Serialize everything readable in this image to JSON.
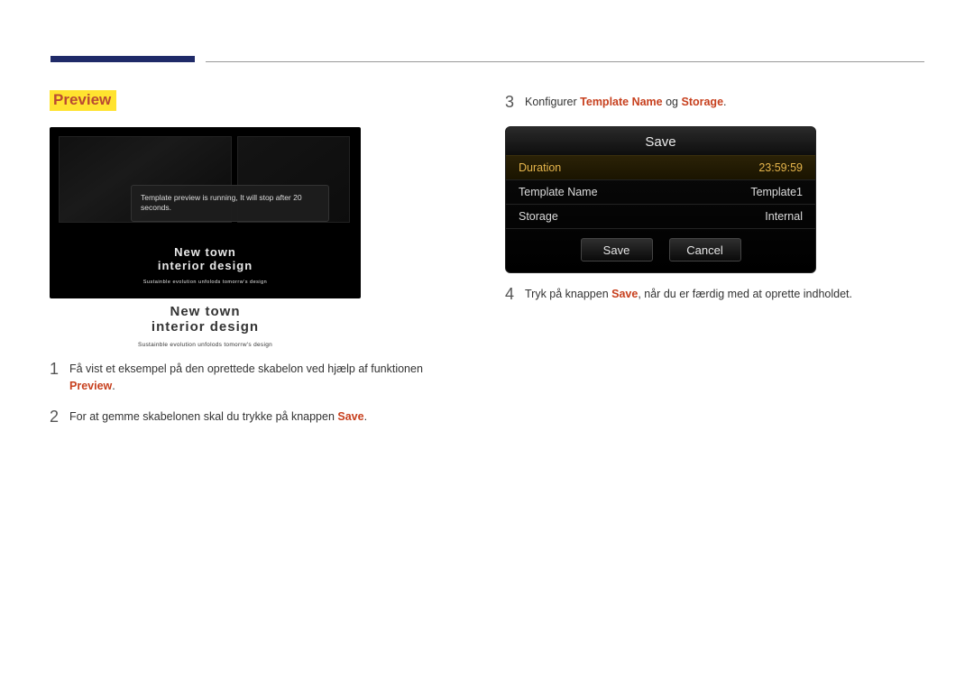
{
  "header": {
    "section_label": "Preview"
  },
  "preview_toast": "Template preview is running, It will stop after 20 seconds.",
  "preview_title_line1": "New town",
  "preview_title_line2": "interior design",
  "preview_subtitle": "Sustainble evolution unfolods tomorrw's design",
  "steps": {
    "s1_prefix": "Få vist et eksempel på den oprettede skabelon ved hjælp af funktionen ",
    "s1_kw": "Preview",
    "s1_suffix": ".",
    "s2_prefix": "For at gemme skabelonen skal du trykke på knappen ",
    "s2_kw": "Save",
    "s2_suffix": ".",
    "s3_prefix": "Konfigurer ",
    "s3_kw1": "Template Name",
    "s3_mid": " og ",
    "s3_kw2": "Storage",
    "s3_suffix": ".",
    "s4_prefix": "Tryk på knappen ",
    "s4_kw": "Save",
    "s4_suffix": ", når du er færdig med at oprette indholdet.",
    "n1": "1",
    "n2": "2",
    "n3": "3",
    "n4": "4"
  },
  "save_dialog": {
    "title": "Save",
    "rows": {
      "duration_label": "Duration",
      "duration_value": "23:59:59",
      "template_label": "Template Name",
      "template_value": "Template1",
      "storage_label": "Storage",
      "storage_value": "Internal"
    },
    "save_btn": "Save",
    "cancel_btn": "Cancel"
  }
}
